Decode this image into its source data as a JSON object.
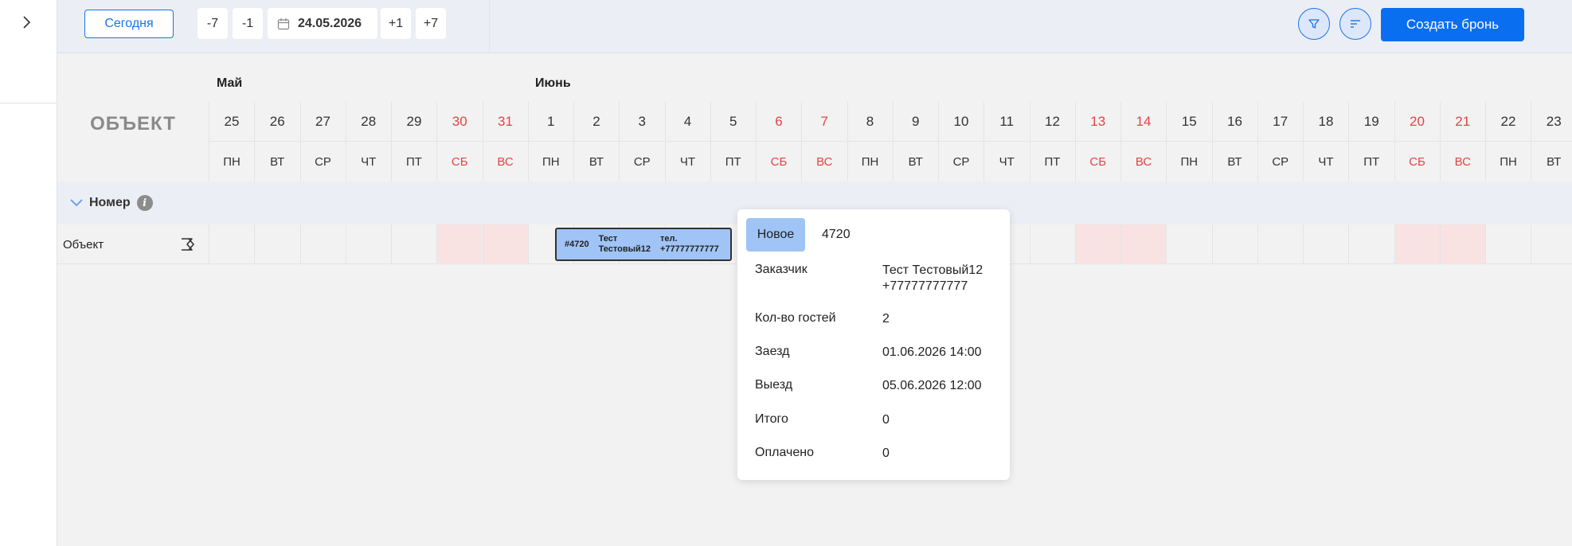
{
  "toolbar": {
    "today_label": "Сегодня",
    "minus7": "-7",
    "minus1": "-1",
    "date": "24.05.2026",
    "plus1": "+1",
    "plus7": "+7",
    "create_label": "Создать бронь"
  },
  "calendar": {
    "object_header": "ОБЪЕКТ",
    "months": [
      "Май",
      "Июнь"
    ],
    "days": [
      {
        "num": "25",
        "name": "ПН",
        "weekend": false
      },
      {
        "num": "26",
        "name": "ВТ",
        "weekend": false
      },
      {
        "num": "27",
        "name": "СР",
        "weekend": false
      },
      {
        "num": "28",
        "name": "ЧТ",
        "weekend": false
      },
      {
        "num": "29",
        "name": "ПТ",
        "weekend": false
      },
      {
        "num": "30",
        "name": "СБ",
        "weekend": true
      },
      {
        "num": "31",
        "name": "ВС",
        "weekend": true
      },
      {
        "num": "1",
        "name": "ПН",
        "weekend": false
      },
      {
        "num": "2",
        "name": "ВТ",
        "weekend": false
      },
      {
        "num": "3",
        "name": "СР",
        "weekend": false
      },
      {
        "num": "4",
        "name": "ЧТ",
        "weekend": false
      },
      {
        "num": "5",
        "name": "ПТ",
        "weekend": false
      },
      {
        "num": "6",
        "name": "СБ",
        "weekend": true
      },
      {
        "num": "7",
        "name": "ВС",
        "weekend": true
      },
      {
        "num": "8",
        "name": "ПН",
        "weekend": false
      },
      {
        "num": "9",
        "name": "ВТ",
        "weekend": false
      },
      {
        "num": "10",
        "name": "СР",
        "weekend": false
      },
      {
        "num": "11",
        "name": "ЧТ",
        "weekend": false
      },
      {
        "num": "12",
        "name": "ПТ",
        "weekend": false
      },
      {
        "num": "13",
        "name": "СБ",
        "weekend": true
      },
      {
        "num": "14",
        "name": "ВС",
        "weekend": true
      },
      {
        "num": "15",
        "name": "ПН",
        "weekend": false
      },
      {
        "num": "16",
        "name": "ВТ",
        "weekend": false
      },
      {
        "num": "17",
        "name": "СР",
        "weekend": false
      },
      {
        "num": "18",
        "name": "ЧТ",
        "weekend": false
      },
      {
        "num": "19",
        "name": "ПТ",
        "weekend": false
      },
      {
        "num": "20",
        "name": "СБ",
        "weekend": true
      },
      {
        "num": "21",
        "name": "ВС",
        "weekend": true
      },
      {
        "num": "22",
        "name": "ПН",
        "weekend": false
      },
      {
        "num": "23",
        "name": "ВТ",
        "weekend": false
      }
    ],
    "weekend_color": "#e04545"
  },
  "group": {
    "label": "Номер",
    "info_glyph": "i"
  },
  "row": {
    "object_name": "Объект"
  },
  "booking": {
    "id": "#4720",
    "name_line1": "Тест",
    "name_line2": "Тестовый12",
    "phone_line1": "тел.",
    "phone_line2": "+77777777777",
    "color": "#9fc4f5"
  },
  "popup": {
    "status": "Новое",
    "booking_number": "4720",
    "customer_label": "Заказчик",
    "customer_name": "Тест Тестовый12",
    "customer_phone": "+77777777777",
    "guests_label": "Кол-во гостей",
    "guests_value": "2",
    "checkin_label": "Заезд",
    "checkin_value": "01.06.2026 14:00",
    "checkout_label": "Выезд",
    "checkout_value": "05.06.2026 12:00",
    "total_label": "Итого",
    "total_value": "0",
    "paid_label": "Оплачено",
    "paid_value": "0"
  }
}
